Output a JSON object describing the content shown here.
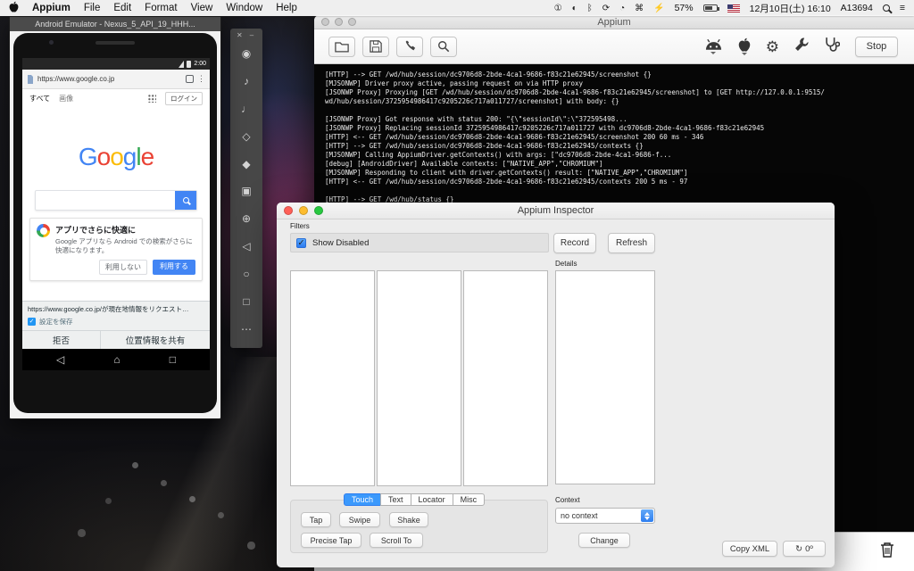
{
  "menubar": {
    "menus": [
      "Appium",
      "File",
      "Edit",
      "Format",
      "View",
      "Window",
      "Help"
    ],
    "status_icons": [
      {
        "name": "circle-1-icon",
        "glyph": "①"
      },
      {
        "name": "display-icon",
        "glyph": "◐"
      },
      {
        "name": "bluetooth-icon",
        "glyph": "ᛒ"
      },
      {
        "name": "time-machine-icon",
        "glyph": "⟳"
      },
      {
        "name": "volume-icon",
        "glyph": "◔"
      },
      {
        "name": "keyboard-icon",
        "glyph": "⌘"
      },
      {
        "name": "battery-app-icon",
        "glyph": "⚡"
      }
    ],
    "battery_percent": "57%",
    "datetime": "12月10日(土) 16:10",
    "username": "A13694",
    "notification_list_glyph": "≡"
  },
  "emulator": {
    "window_title": "Android Emulator - Nexus_5_API_19_HHH...",
    "status_time": "2:00",
    "url": "https://www.google.co.jp",
    "browser_menu_glyph": "⋮",
    "nav_tab_all": "すべて",
    "nav_tab_images": "画像",
    "login_button": "ログイン",
    "logo_letters": [
      "G",
      "o",
      "o",
      "g",
      "l",
      "e"
    ],
    "promo_title": "アプリでさらに快適に",
    "promo_body": "Google アプリなら Android での検索がさらに快適になります。",
    "promo_decline": "利用しない",
    "promo_accept": "利用する",
    "location_message": "https://www.google.co.jp/が現在地情報をリクエスト…",
    "location_check_glyph": "✓",
    "location_save_setting": "設定を保存",
    "location_deny": "拒否",
    "location_share": "位置情報を共有",
    "navbar_icons": [
      {
        "name": "back-icon",
        "glyph": "◁"
      },
      {
        "name": "home-icon",
        "glyph": "⌂"
      },
      {
        "name": "recents-icon",
        "glyph": "□"
      }
    ]
  },
  "emulator_toolbar": {
    "close_glyph": "✕",
    "minimize_glyph": "–",
    "buttons": [
      {
        "name": "power-icon",
        "glyph": "◉"
      },
      {
        "name": "volume-up-icon",
        "glyph": "♪"
      },
      {
        "name": "volume-down-icon",
        "glyph": "♩"
      },
      {
        "name": "rotate-left-icon",
        "glyph": "◇"
      },
      {
        "name": "rotate-right-icon",
        "glyph": "◆"
      },
      {
        "name": "screenshot-icon",
        "glyph": "▣"
      },
      {
        "name": "zoom-icon",
        "glyph": "⊕"
      },
      {
        "name": "back-icon",
        "glyph": "◁"
      },
      {
        "name": "home-icon",
        "glyph": "○"
      },
      {
        "name": "overview-icon",
        "glyph": "□"
      },
      {
        "name": "more-icon",
        "glyph": "⋯"
      }
    ]
  },
  "appium_server": {
    "window_title": "Appium",
    "stop_button": "Stop",
    "gear_glyph": "⚙",
    "toolbar_icons_left": [
      "open-file-icon",
      "save-icon",
      "handset-icon",
      "search-icon"
    ],
    "toolbar_icons_right": [
      "android-settings-icon",
      "apple-settings-icon",
      "general-settings-icon",
      "developer-settings-icon",
      "doctor-icon"
    ],
    "log_lines": [
      "[HTTP] --> GET /wd/hub/session/dc9706d8-2bde-4ca1-9686-f83c21e62945/screenshot {}",
      "[MJSONWP] Driver proxy active, passing request on via HTTP proxy",
      "[JSONWP Proxy] Proxying [GET /wd/hub/session/dc9706d8-2bde-4ca1-9686-f83c21e62945/screenshot] to [GET http://127.0.0.1:9515/",
      "wd/hub/session/3725954986417c9205226c717a011727/screenshot] with body: {}",
      "",
      "[JSONWP Proxy] Got response with status 200: \"{\\\"sessionId\\\":\\\"372595498...",
      "[JSONWP Proxy] Replacing sessionId 3725954986417c9205226c717a011727 with dc9706d8-2bde-4ca1-9686-f83c21e62945",
      "[HTTP] <-- GET /wd/hub/session/dc9706d8-2bde-4ca1-9686-f83c21e62945/screenshot 200 60 ms - 346",
      "[HTTP] --> GET /wd/hub/session/dc9706d8-2bde-4ca1-9686-f83c21e62945/contexts {}",
      "[MJSONWP] Calling AppiumDriver.getContexts() with args: [\"dc9706d8-2bde-4ca1-9686-f...",
      "[debug] [AndroidDriver] Available contexts: [\"NATIVE_APP\",\"CHROMIUM\"]",
      "[MJSONWP] Responding to client with driver.getContexts() result: [\"NATIVE_APP\",\"CHROMIUM\"]",
      "[HTTP] <-- GET /wd/hub/session/dc9706d8-2bde-4ca1-9686-f83c21e62945/contexts 200 5 ms - 97",
      "",
      "[HTTP] --> GET /wd/hub/status {}"
    ]
  },
  "inspector": {
    "window_title": "Appium Inspector",
    "filters_label": "Filters",
    "show_disabled_label": "Show Disabled",
    "check_glyph": "✓",
    "record_button": "Record",
    "refresh_button": "Refresh",
    "details_label": "Details",
    "tabs": [
      "Touch",
      "Text",
      "Locator",
      "Misc"
    ],
    "touch_buttons_row1": [
      "Tap",
      "Swipe",
      "Shake"
    ],
    "touch_buttons_row2": [
      "Precise Tap",
      "Scroll To"
    ],
    "context_label": "Context",
    "context_value": "no context",
    "change_button": "Change",
    "copy_xml_button": "Copy XML",
    "rotate_glyph": "↻",
    "rotation_value": "0º"
  },
  "colors": {
    "accent_blue": "#3b99fc",
    "google_blue": "#4285F4",
    "google_red": "#EA4335",
    "google_yellow": "#FBBC05",
    "google_green": "#34A853"
  }
}
